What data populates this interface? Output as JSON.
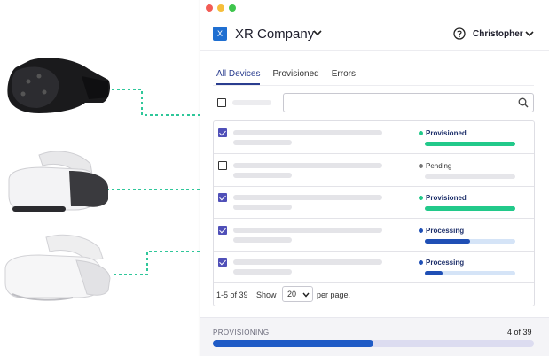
{
  "window": {
    "brand": {
      "logo_letter": "X",
      "name": "XR Company"
    },
    "user": {
      "name": "Christopher"
    }
  },
  "tabs": [
    {
      "label": "All Devices",
      "active": true
    },
    {
      "label": "Provisioned",
      "active": false
    },
    {
      "label": "Errors",
      "active": false
    }
  ],
  "search": {
    "placeholder": ""
  },
  "table": {
    "rows": [
      {
        "checked": true,
        "status": "Provisioned",
        "status_color": "#22c98a",
        "progress": 1.0,
        "bar_color": "#22c98a",
        "bold": true
      },
      {
        "checked": false,
        "status": "Pending",
        "status_color": "#777777",
        "progress": 0.0,
        "bar_color": "#bbbbbb",
        "bold": false
      },
      {
        "checked": true,
        "status": "Provisioned",
        "status_color": "#22c98a",
        "progress": 1.0,
        "bar_color": "#22c98a",
        "bold": true
      },
      {
        "checked": true,
        "status": "Processing",
        "status_color": "#1f4fb5",
        "progress": 0.5,
        "bar_color": "#1f4fb5",
        "bold": true
      },
      {
        "checked": true,
        "status": "Processing",
        "status_color": "#1f4fb5",
        "progress": 0.2,
        "bar_color": "#1f4fb5",
        "bold": true
      }
    ],
    "footer": {
      "range": "1-5 of 39",
      "show_label": "Show",
      "per_page_value": "20",
      "per_page_suffix": "per page."
    }
  },
  "provisioning": {
    "label": "PROVISIONING",
    "count": "4 of 39",
    "progress": 0.5
  },
  "colors": {
    "accent": "#2a3d8f",
    "connector": "#2fc79a",
    "brand": "#1f6fd1"
  }
}
